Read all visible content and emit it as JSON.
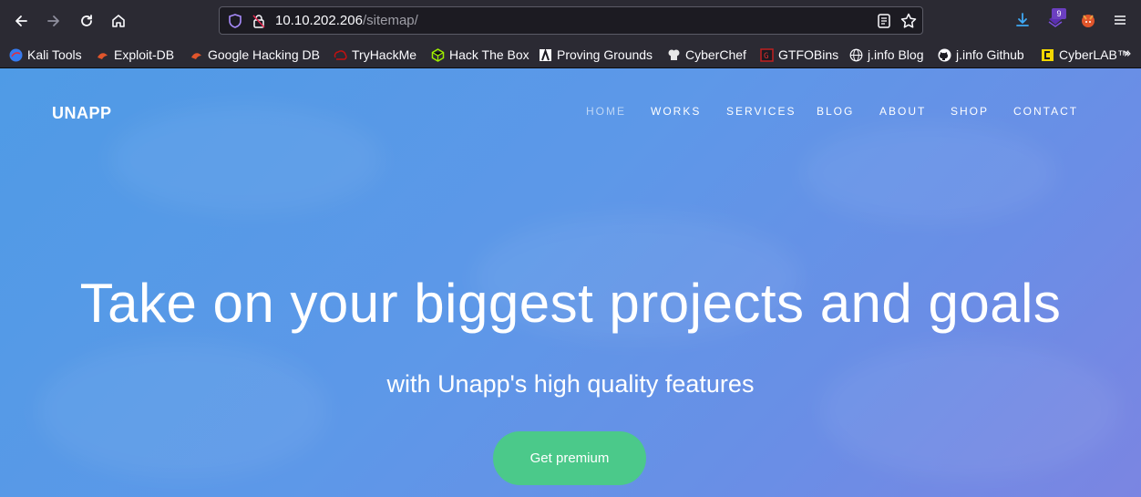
{
  "browser": {
    "url_host": "10.10.202.206",
    "url_path": "/sitemap/",
    "extension_badge": "9",
    "accent_color": "#2b2a33"
  },
  "bookmarks": [
    {
      "label": "Kali Tools",
      "icon": "kali-icon"
    },
    {
      "label": "Exploit-DB",
      "icon": "exploit-db-icon"
    },
    {
      "label": "Google Hacking DB",
      "icon": "ghdb-icon"
    },
    {
      "label": "TryHackMe",
      "icon": "tryhackme-icon"
    },
    {
      "label": "Hack The Box",
      "icon": "htb-icon"
    },
    {
      "label": "Proving Grounds",
      "icon": "proving-grounds-icon"
    },
    {
      "label": "CyberChef",
      "icon": "cyberchef-icon"
    },
    {
      "label": "GTFOBins",
      "icon": "gtfobins-icon"
    },
    {
      "label": "j.info Blog",
      "icon": "globe-icon"
    },
    {
      "label": "j.info Github",
      "icon": "github-icon"
    },
    {
      "label": "CyberLAB™",
      "icon": "cyberlab-icon"
    }
  ],
  "site": {
    "brand": "UNAPP",
    "nav": [
      "HOME",
      "WORKS",
      "SERVICES",
      "BLOG",
      "ABOUT",
      "SHOP",
      "CONTACT"
    ],
    "hero_title": "Take on your biggest projects and goals",
    "hero_subtitle": "with Unapp's high quality features",
    "cta_label": "Get premium",
    "cta_color": "#4bc98a"
  }
}
